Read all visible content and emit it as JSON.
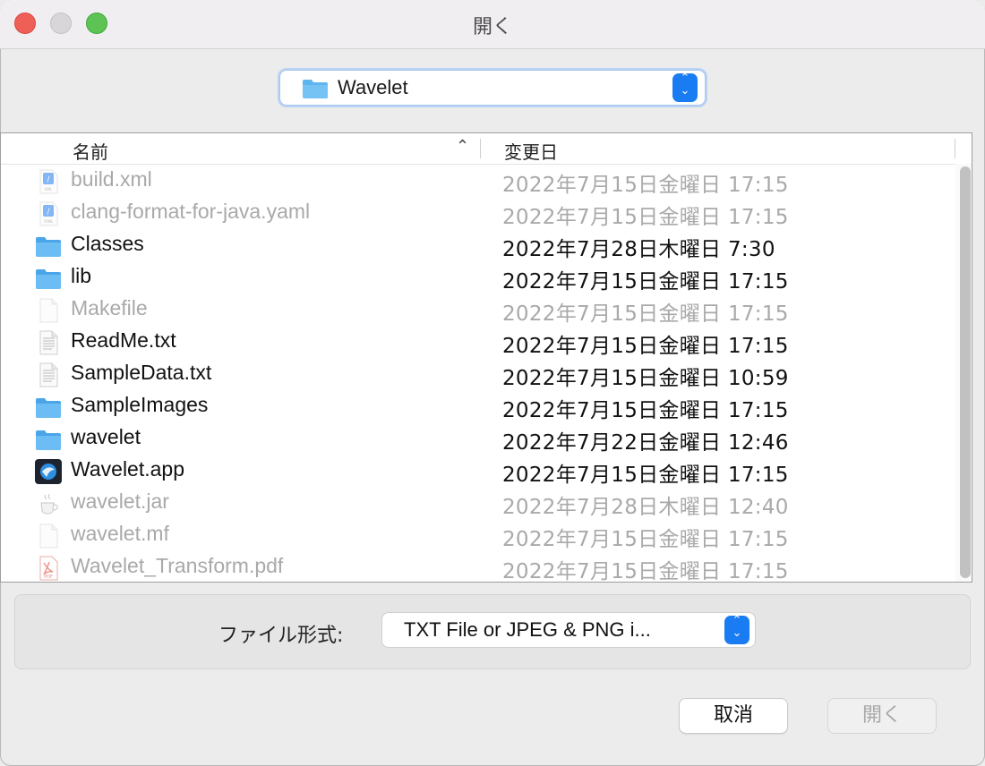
{
  "window": {
    "title": "開く"
  },
  "location": {
    "folder": "Wavelet",
    "icon": "folder-icon"
  },
  "columns": {
    "name": "名前",
    "date": "変更日"
  },
  "files": [
    {
      "name": "build.xml",
      "date": "2022年7月15日金曜日 17:15",
      "icon": "xml-file-icon",
      "enabled": false
    },
    {
      "name": "clang-format-for-java.yaml",
      "date": "2022年7月15日金曜日 17:15",
      "icon": "yaml-file-icon",
      "enabled": false
    },
    {
      "name": "Classes",
      "date": "2022年7月28日木曜日 7:30",
      "icon": "folder-icon",
      "enabled": true
    },
    {
      "name": "lib",
      "date": "2022年7月15日金曜日 17:15",
      "icon": "folder-icon",
      "enabled": true
    },
    {
      "name": "Makefile",
      "date": "2022年7月15日金曜日 17:15",
      "icon": "blank-file-icon",
      "enabled": false
    },
    {
      "name": "ReadMe.txt",
      "date": "2022年7月15日金曜日 17:15",
      "icon": "text-file-icon",
      "enabled": true
    },
    {
      "name": "SampleData.txt",
      "date": "2022年7月15日金曜日 10:59",
      "icon": "text-file-icon",
      "enabled": true
    },
    {
      "name": "SampleImages",
      "date": "2022年7月15日金曜日 17:15",
      "icon": "folder-icon",
      "enabled": true
    },
    {
      "name": "wavelet",
      "date": "2022年7月22日金曜日 12:46",
      "icon": "folder-icon",
      "enabled": true
    },
    {
      "name": "Wavelet.app",
      "date": "2022年7月15日金曜日 17:15",
      "icon": "app-icon",
      "enabled": true
    },
    {
      "name": "wavelet.jar",
      "date": "2022年7月28日木曜日 12:40",
      "icon": "java-coffee-icon",
      "enabled": false
    },
    {
      "name": "wavelet.mf",
      "date": "2022年7月15日金曜日 17:15",
      "icon": "blank-file-icon",
      "enabled": false
    },
    {
      "name": "Wavelet_Transform.pdf",
      "date": "2022年7月15日金曜日 17:15",
      "icon": "pdf-file-icon",
      "enabled": false
    }
  ],
  "filter": {
    "label": "ファイル形式:",
    "value": "TXT File or JPEG & PNG i..."
  },
  "buttons": {
    "cancel": "取消",
    "open": "開く"
  },
  "colors": {
    "accent": "#1a7cf2",
    "folder": "#5eb4ef",
    "close": "#ee5f58",
    "maximize": "#5cc354"
  }
}
